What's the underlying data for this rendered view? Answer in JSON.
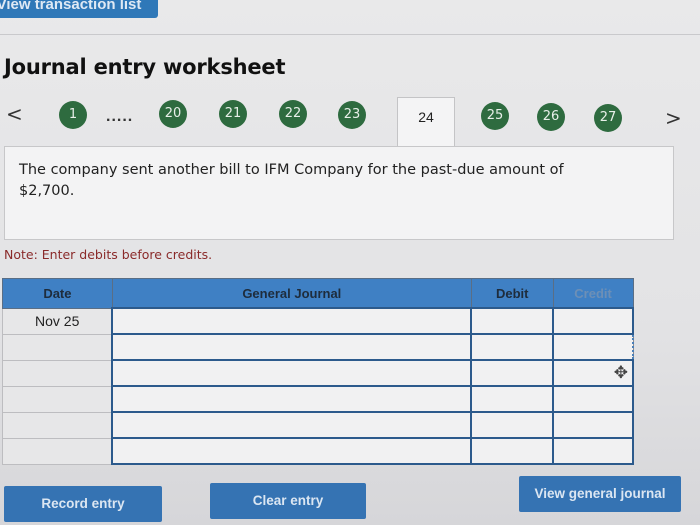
{
  "top_button": "View transaction list",
  "title": "Journal entry worksheet",
  "nav": {
    "prev": "<",
    "next": ">",
    "first": "1",
    "dots": ".....",
    "tabs": [
      "20",
      "21",
      "22",
      "23",
      "24",
      "25",
      "26",
      "27"
    ],
    "active_tab": "24"
  },
  "description": "The company sent another bill to IFM Company for the past-due amount of $2,700.",
  "note": "Note: Enter debits before credits.",
  "table": {
    "headers": {
      "date": "Date",
      "journal": "General Journal",
      "debit": "Debit",
      "credit": "Credit"
    },
    "rows": [
      {
        "date": "Nov 25",
        "journal": "",
        "debit": "",
        "credit": ""
      },
      {
        "date": "",
        "journal": "",
        "debit": "",
        "credit": ""
      },
      {
        "date": "",
        "journal": "",
        "debit": "",
        "credit": ""
      },
      {
        "date": "",
        "journal": "",
        "debit": "",
        "credit": ""
      },
      {
        "date": "",
        "journal": "",
        "debit": "",
        "credit": ""
      },
      {
        "date": "",
        "journal": "",
        "debit": "",
        "credit": ""
      }
    ]
  },
  "buttons": {
    "record": "Record entry",
    "clear": "Clear entry",
    "view": "View general journal"
  },
  "colors": {
    "accent_blue": "#3573b3",
    "tab_green": "#2e6b3f",
    "note_red": "#8a2a2a"
  },
  "icons": {
    "cursor": "move-cursor-icon"
  }
}
